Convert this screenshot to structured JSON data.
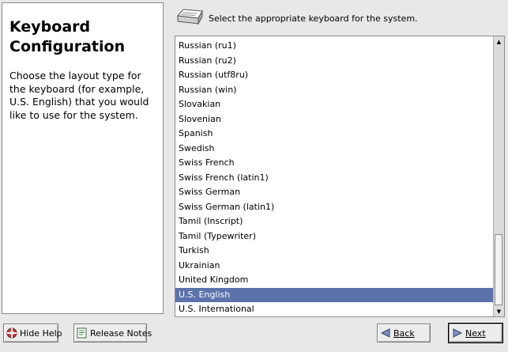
{
  "help": {
    "title": "Keyboard Configuration",
    "text": "Choose the layout type for the keyboard (for example, U.S. English) that you would like to use for the system."
  },
  "header": {
    "instruction": "Select the appropriate keyboard for the system.",
    "icon": "keyboard-icon"
  },
  "keyboard_list": {
    "items": [
      "Russian (ru1)",
      "Russian (ru2)",
      "Russian (utf8ru)",
      "Russian (win)",
      "Slovakian",
      "Slovenian",
      "Spanish",
      "Swedish",
      "Swiss French",
      "Swiss French (latin1)",
      "Swiss German",
      "Swiss German (latin1)",
      "Tamil (Inscript)",
      "Tamil (Typewriter)",
      "Turkish",
      "Ukrainian",
      "United Kingdom",
      "U.S. English",
      "U.S. International"
    ],
    "selected": "U.S. English",
    "selection_color": "#5b72ab"
  },
  "buttons": {
    "hide_help": "Hide Help",
    "release_notes": "Release Notes",
    "back": "Back",
    "next": "Next"
  }
}
